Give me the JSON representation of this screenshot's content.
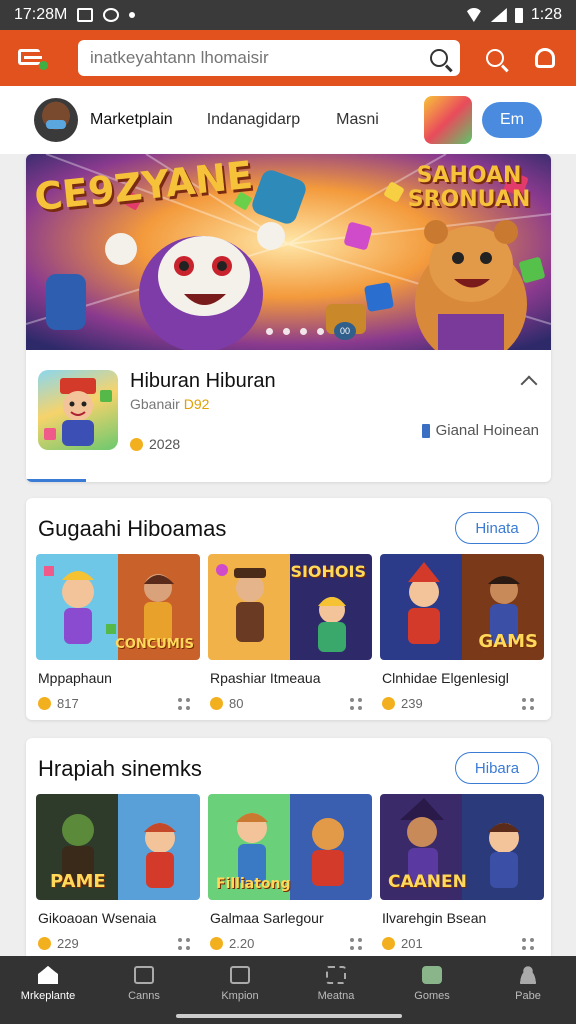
{
  "status_bar": {
    "time": "17:28M",
    "right_time": "1:28"
  },
  "app_bar": {
    "search_placeholder": "inatkeyahtann lhomaisir",
    "icons": [
      "app-logo-icon",
      "search-icon",
      "notification-icon"
    ]
  },
  "top_nav": {
    "tabs": [
      "Marketplain",
      "Indanagidarp",
      "Masni"
    ],
    "button_label": "Em"
  },
  "hero": {
    "banner_title_left": "CE9ZYANE",
    "banner_title_right": "SAHOAN SRONUAN",
    "page_badge": "00",
    "app_name": "Hiburan Hiburan",
    "app_sub_prefix": "Gbanair",
    "app_sub_highlight": "D92",
    "app_year": "2028",
    "genre": "Gianal Hoinean",
    "colors": {
      "accent": "#3a7bd5",
      "brand": "#e2521e"
    }
  },
  "sections": [
    {
      "title": "Gugaahi Hiboamas",
      "button": "Hinata",
      "tiles": [
        {
          "name": "Mppaphaun",
          "count": "817",
          "label": "CONCUMIS"
        },
        {
          "name": "Rpashiar Itmeaua",
          "count": "80",
          "label": "SIOHOIS"
        },
        {
          "name": "Clnhidae Elgenlesigl",
          "count": "239",
          "label": "GAMS"
        }
      ]
    },
    {
      "title": "Hrapiah sinemks",
      "button": "Hibara",
      "tiles": [
        {
          "name": "Gikoaoan Wsenaia",
          "count": "229",
          "label": "PAME"
        },
        {
          "name": "Galmaa Sarlegour",
          "count": "2.20",
          "label": "Filliatong"
        },
        {
          "name": "Ilvarehgin Bsean",
          "count": "201",
          "label": "CAANEN"
        }
      ]
    }
  ],
  "bottom_nav": [
    {
      "label": "Mrkeplante",
      "icon": "home-icon"
    },
    {
      "label": "Canns",
      "icon": "games-icon"
    },
    {
      "label": "Kmpion",
      "icon": "image-icon"
    },
    {
      "label": "Meatna",
      "icon": "grid-icon"
    },
    {
      "label": "Gomes",
      "icon": "chat-icon"
    },
    {
      "label": "Pabe",
      "icon": "profile-icon"
    }
  ]
}
